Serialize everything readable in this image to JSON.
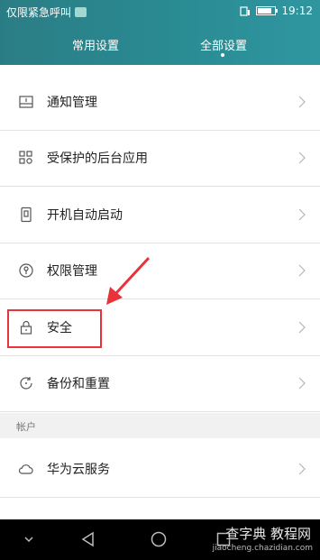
{
  "status_bar": {
    "carrier": "仅限紧急呼叫",
    "time": "19:12",
    "battery_level": 0.8
  },
  "tabs": [
    {
      "label": "常用设置",
      "selected": false
    },
    {
      "label": "全部设置",
      "selected": true
    }
  ],
  "settings": [
    {
      "label": "通知管理",
      "icon": "notification-icon"
    },
    {
      "label": "受保护的后台应用",
      "icon": "protected-apps-icon"
    },
    {
      "label": "开机自动启动",
      "icon": "autostart-icon"
    },
    {
      "label": "权限管理",
      "icon": "permission-icon"
    },
    {
      "label": "安全",
      "icon": "lock-icon"
    },
    {
      "label": "备份和重置",
      "icon": "backup-icon"
    }
  ],
  "account_section": {
    "header": "帐户",
    "items": [
      {
        "label": "华为云服务",
        "icon": "cloud-icon"
      }
    ]
  },
  "watermark": {
    "text": "查字典 教程网",
    "url": "jiaocheng.chazidian.com"
  },
  "colors": {
    "header": "#2a8b93",
    "highlight": "#e8333a",
    "navbar": "#000000"
  }
}
